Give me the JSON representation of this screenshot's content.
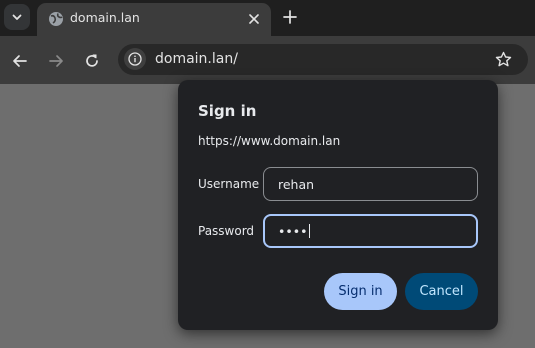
{
  "tab": {
    "title": "domain.lan"
  },
  "omnibox": {
    "url": "domain.lan/"
  },
  "dialog": {
    "title": "Sign in",
    "origin": "https://www.domain.lan",
    "username_label": "Username",
    "username_value": "rehan",
    "password_label": "Password",
    "password_value": "••••",
    "sign_in_label": "Sign in",
    "cancel_label": "Cancel"
  },
  "colors": {
    "accent": "#a8c7fa",
    "cancel_bg": "#004a77",
    "dialog_bg": "#202124"
  }
}
